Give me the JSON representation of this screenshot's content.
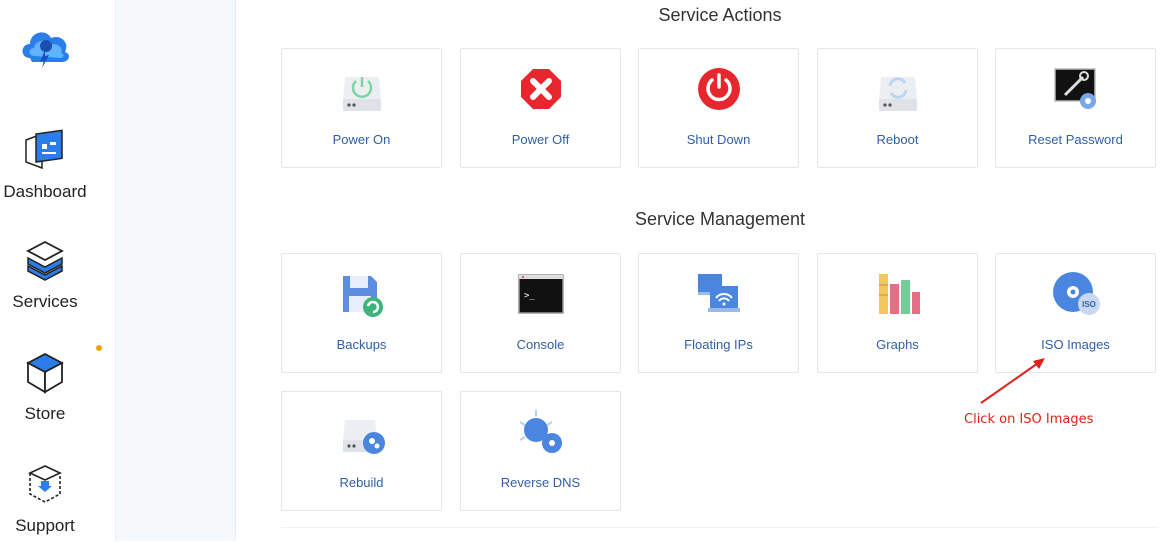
{
  "sidebar": {
    "items": [
      {
        "label": "Dashboard",
        "icon": "dashboard-icon"
      },
      {
        "label": "Services",
        "icon": "services-icon"
      },
      {
        "label": "Store",
        "icon": "store-icon"
      },
      {
        "label": "Support",
        "icon": "support-icon"
      }
    ]
  },
  "actions": {
    "title": "Service Actions",
    "items": [
      {
        "label": "Power On",
        "icon": "power-on-icon"
      },
      {
        "label": "Power Off",
        "icon": "power-off-icon"
      },
      {
        "label": "Shut Down",
        "icon": "shut-down-icon"
      },
      {
        "label": "Reboot",
        "icon": "reboot-icon"
      },
      {
        "label": "Reset Password",
        "icon": "reset-password-icon"
      }
    ]
  },
  "management": {
    "title": "Service Management",
    "items": [
      {
        "label": "Backups",
        "icon": "backups-icon"
      },
      {
        "label": "Console",
        "icon": "console-icon"
      },
      {
        "label": "Floating IPs",
        "icon": "floating-ips-icon"
      },
      {
        "label": "Graphs",
        "icon": "graphs-icon"
      },
      {
        "label": "ISO Images",
        "icon": "iso-images-icon"
      },
      {
        "label": "Rebuild",
        "icon": "rebuild-icon"
      },
      {
        "label": "Reverse DNS",
        "icon": "reverse-dns-icon"
      }
    ]
  },
  "annotation": {
    "text": "Click on ISO Images"
  },
  "icon_texts": {
    "iso": "ISO",
    "console": ">_"
  },
  "colors": {
    "accent": "#2f5fa5",
    "annotation": "#e0201b",
    "notification_dot": "#f2a100"
  }
}
